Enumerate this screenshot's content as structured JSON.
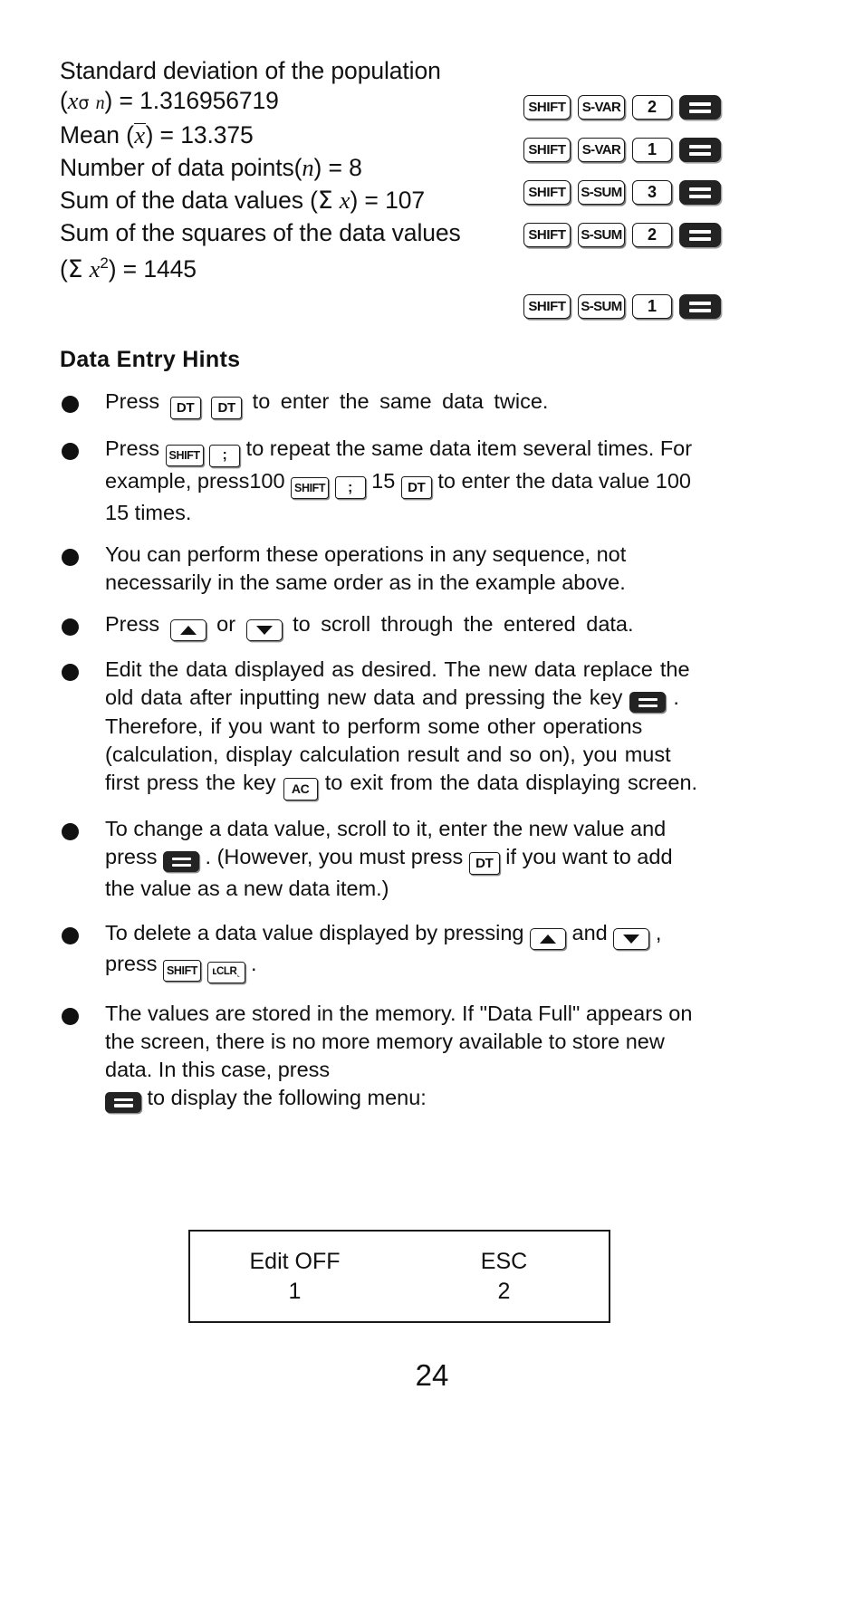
{
  "document": {
    "page_number": "24",
    "section_heading": "Data  Entry Hints"
  },
  "results": [
    {
      "label_line1": "Standard deviation of the population",
      "label_line2_prefix": "(",
      "var_italic": "x",
      "var_sigma": "σ",
      "var_sub": "n",
      "label_line2_suffix": ") = ",
      "value": "1.316956719",
      "keys": [
        "SHIFT",
        "S-VAR",
        "2",
        "="
      ]
    },
    {
      "label": "Mean (",
      "var_overline": "x",
      "label_suffix": ") = ",
      "value": "13.375",
      "keys": [
        "SHIFT",
        "S-VAR",
        "1",
        "="
      ]
    },
    {
      "label": "Number of data points(",
      "var_italic": "n",
      "label_suffix": ") = ",
      "value": "8",
      "keys": [
        "SHIFT",
        "S-SUM",
        "3",
        "="
      ]
    },
    {
      "label": "Sum of the data values (",
      "var_sigma": "Σ",
      "var_italic": "x",
      "label_suffix": ") = ",
      "value": "107",
      "keys": [
        "SHIFT",
        "S-SUM",
        "2",
        "="
      ]
    },
    {
      "label_line1": "Sum of the squares of the data values",
      "label_line2_prefix": "(",
      "var_sigma": "Σ",
      "var_italic": "x",
      "var_sup": "2",
      "label_line2_suffix": ") = ",
      "value": "1445",
      "keys": [
        "SHIFT",
        "S-SUM",
        "1",
        "="
      ]
    }
  ],
  "hints": [
    {
      "id": "hint-press-dt-dt",
      "parts": [
        "Press ",
        "[DT]",
        "[DT]",
        " to  enter  the  same  data  twice."
      ]
    },
    {
      "id": "hint-press-shift-semicolon",
      "text_a": "Press ",
      "key1": "SHIFT",
      "key2": ";",
      "text_b": " to repeat the same data item several times.  For  example,  press",
      "text_c": "100 ",
      "key3": "SHIFT",
      "key4": ";",
      "text_d": " 15 ",
      "key5": "DT",
      "text_e": " to enter the data value 100 15 times."
    },
    {
      "id": "hint-any-sequence",
      "text": "You can perform these operations in any sequence, not necessarily in the same order as in the example above."
    },
    {
      "id": "hint-scroll-arrows",
      "text_a": "Press ",
      "key_up": "arrow-up",
      "text_b": " or ",
      "key_down": "arrow-down",
      "text_c": " to  scroll  through  the  entered  data."
    },
    {
      "id": "hint-edit-data",
      "text_a": "Edit the data displayed as desired. The new data replace the old data after inputting new data and pressing  the  key ",
      "key_eq": "=",
      "text_b": " . Therefore,  if  you  want  to perform  some  other  operations  (calculation, display calculation result and so on), you must first press the key ",
      "key_ac": "AC",
      "text_c": " to exit from the data displaying screen."
    },
    {
      "id": "hint-change-value",
      "text_a": "To  change  a  data  value,  scroll  to  it,  enter  the  new value and press ",
      "key_eq": "=",
      "text_b": " . (However, you must press ",
      "key_dt": "DT",
      "text_c": " if you want to add the value as a new data item.)"
    },
    {
      "id": "hint-delete-value",
      "text_a": "To delete a data value displayed by pressing ",
      "key_up": "arrow-up",
      "text_b": " and ",
      "key_down": "arrow-down",
      "text_c": " , press ",
      "key_shift": "SHIFT",
      "key_clr": "CLR",
      "text_d": " ."
    },
    {
      "id": "hint-data-full",
      "text_a": "The  values  are  stored  in  the  memory.  If  \"Data  Full\" appears  on  the  screen,  there  is  no  more  memory available  to  store  new  data.  In  this  case,  press ",
      "key_eq": "=",
      "text_b": " to display the following menu:"
    }
  ],
  "menu": {
    "items": [
      {
        "label": "Edit OFF",
        "number": "1"
      },
      {
        "label": "ESC",
        "number": "2"
      }
    ]
  },
  "colors": {
    "ink": "#111111",
    "key_fill": "#ffffff",
    "key_border": "#1a1a1a",
    "equals_fill": "#232323",
    "page_bg": "#ffffff"
  }
}
